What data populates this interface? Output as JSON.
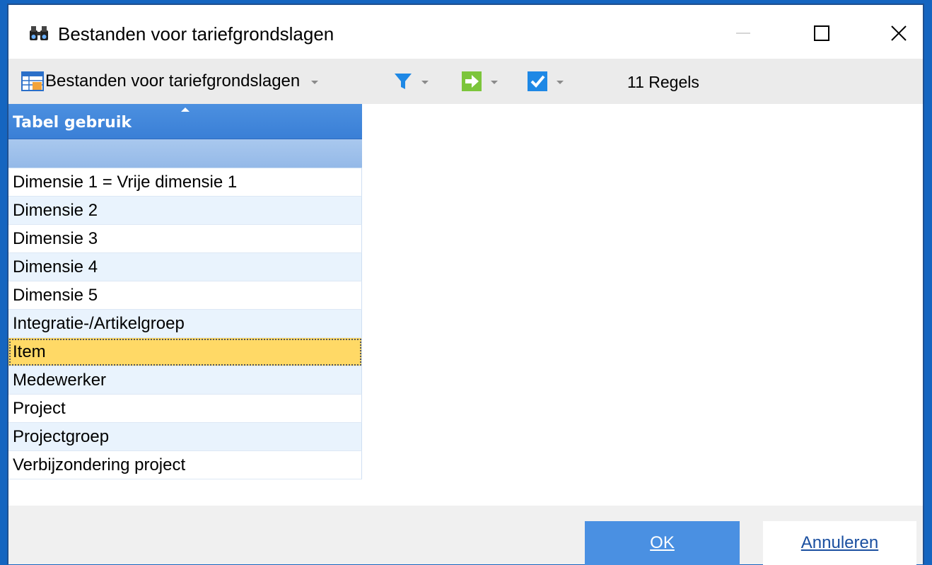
{
  "window": {
    "title": "Bestanden voor tariefgrondslagen"
  },
  "toolbar": {
    "view_label": "Bestanden voor tariefgrondslagen",
    "row_count": "11 Regels"
  },
  "grid": {
    "column_header": "Tabel gebruik",
    "rows": [
      "Dimensie 1 = Vrije dimensie 1",
      "Dimensie 2",
      "Dimensie 3",
      "Dimensie 4",
      "Dimensie 5",
      "Integratie-/Artikelgroep",
      "Item",
      "Medewerker",
      "Project",
      "Projectgroep",
      "Verbijzondering project"
    ],
    "selected_row": "Item"
  },
  "buttons": {
    "ok": "OK",
    "cancel": "Annuleren"
  },
  "colors": {
    "accent": "#4a90e2",
    "selection": "#ffd966",
    "header": "#3a7fd6"
  }
}
